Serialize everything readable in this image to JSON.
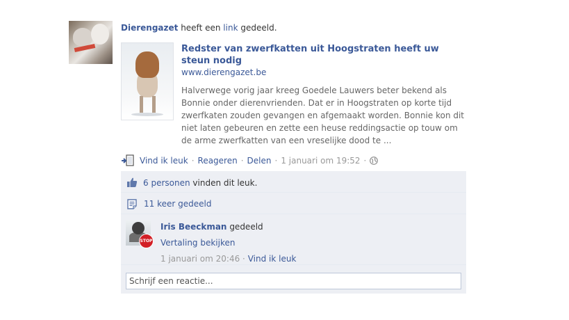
{
  "post": {
    "author": "Dierengazet",
    "verb": "heeft een",
    "object": "link",
    "suffix": "gedeeld."
  },
  "link_preview": {
    "title": "Redster van zwerfkatten uit Hoogstraten heeft uw steun nodig",
    "domain": "www.dierengazet.be",
    "description": "Halverwege vorig jaar kreeg Goedele Lauwers beter bekend als Bonnie onder dierenvrienden. Dat er in Hoogstraten op korte tijd zwerfkaten zouden gevangen en afgemaakt worden. Bonnie kon dit niet laten gebeuren en zette een heuse reddingsactie op touw om de arme zwerfkatten van een vreselijke dood te ..."
  },
  "actions": {
    "like": "Vind ik leuk",
    "comment": "Reageren",
    "share": "Delen",
    "timestamp": "1 januari om 19:52",
    "privacy_icon": "globe-icon"
  },
  "feedback": {
    "likes_link": "6 personen",
    "likes_suffix": "vinden dit leuk.",
    "shares_text": "11 keer gedeeld",
    "share_entry": {
      "name": "Iris Beeckman",
      "verb": "gedeeld",
      "translate": "Vertaling bekijken",
      "timestamp": "1 januari om 20:46",
      "like": "Vind ik leuk",
      "badge_text": "STOP"
    },
    "comment_placeholder": "Schrijf een reactie..."
  },
  "colors": {
    "link": "#3b5998",
    "feedback_bg": "#edeff4",
    "text": "#333333",
    "muted": "#999999"
  }
}
